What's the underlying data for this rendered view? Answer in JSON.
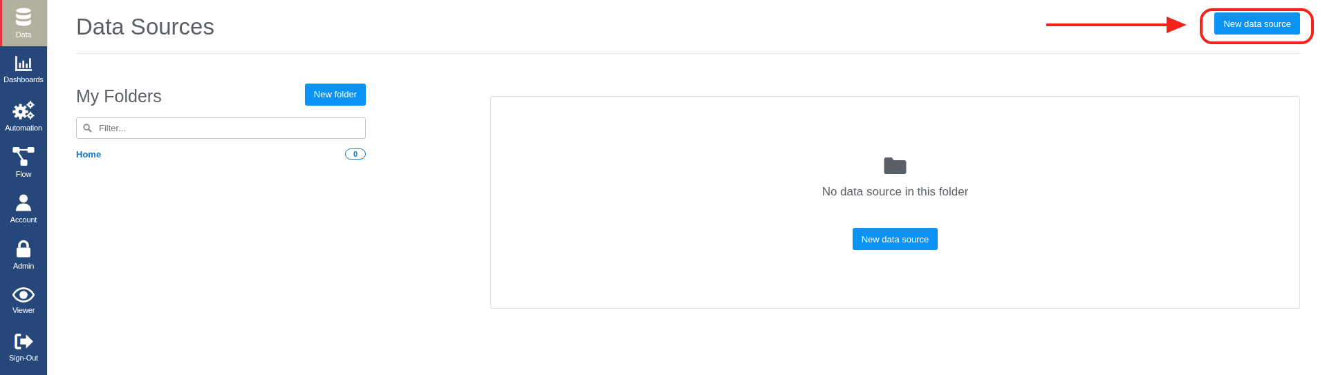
{
  "sidebar": {
    "items": [
      {
        "label": "Data",
        "selected": true
      },
      {
        "label": "Dashboards",
        "selected": false
      },
      {
        "label": "Automation",
        "selected": false
      },
      {
        "label": "Flow",
        "selected": false
      },
      {
        "label": "Account",
        "selected": false
      },
      {
        "label": "Admin",
        "selected": false
      },
      {
        "label": "Viewer",
        "selected": false
      },
      {
        "label": "Sign-Out",
        "selected": false
      }
    ]
  },
  "header": {
    "title": "Data Sources",
    "button": "New data source"
  },
  "folders": {
    "title": "My Folders",
    "button": "New folder",
    "filter": {
      "placeholder": "Filter..."
    },
    "items": [
      {
        "label": "Home",
        "count": "0"
      }
    ]
  },
  "empty_state": {
    "message": "No data source in this folder",
    "button": "New data source"
  }
}
